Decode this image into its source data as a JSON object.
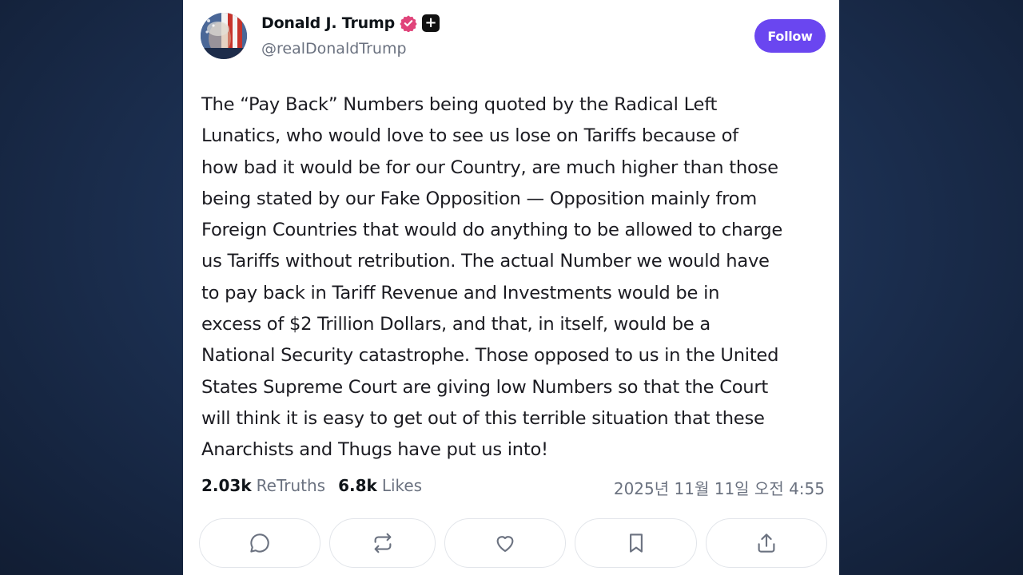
{
  "post": {
    "author": {
      "name": "Donald J. Trump",
      "handle": "@realDonaldTrump",
      "badge_color": "#e0447a",
      "plus_label": "+"
    },
    "follow_label": "Follow",
    "body": "The “Pay Back” Numbers being quoted by the Radical Left\nLunatics, who would love to see us lose on Tariffs because of\nhow bad it would be for our Country, are much higher than those\nbeing stated by our Fake Opposition — Opposition mainly from\nForeign Countries that would do anything to be allowed to charge\nus Tariffs without retribution. The actual Number we would have\nto pay back in Tariff Revenue and Investments would be in\nexcess of $2 Trillion Dollars, and that, in itself, would be a\nNational Security catastrophe. Those opposed to us in the United\nStates Supreme Court are giving low Numbers so that the Court\nwill think it is easy to get out of this terrible situation that these\nAnarchists and Thugs have put us into!",
    "stats": {
      "retruths_count": "2.03k",
      "retruths_label": "ReTruths",
      "likes_count": "6.8k",
      "likes_label": "Likes"
    },
    "timestamp": "2025년 11월 11일 오전 4:55",
    "actions": [
      "reply-icon",
      "retruth-icon",
      "like-icon",
      "bookmark-icon",
      "share-icon"
    ]
  },
  "colors": {
    "accent": "#6a46f0",
    "text": "#1c1c22",
    "muted": "#6b7280",
    "background": "#1c3052"
  }
}
